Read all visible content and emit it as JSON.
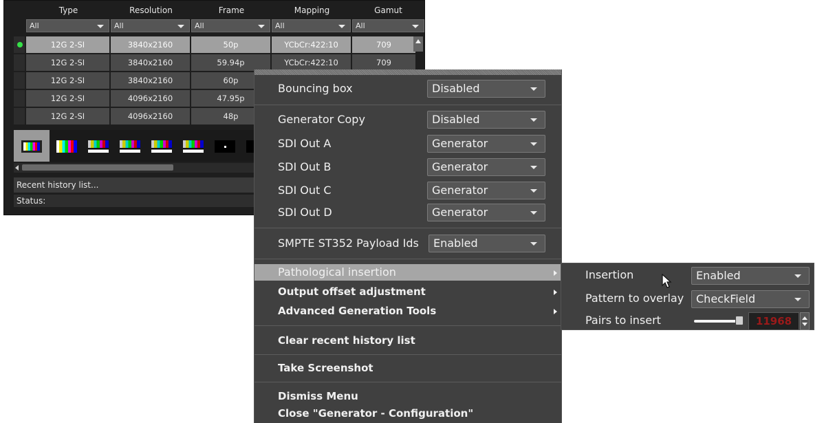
{
  "table": {
    "headers": [
      "Type",
      "Resolution",
      "Frame",
      "Mapping",
      "Gamut"
    ],
    "filters": [
      "All",
      "All",
      "All",
      "All",
      "All"
    ],
    "rows": [
      [
        "12G 2-SI",
        "3840x2160",
        "50p",
        "YCbCr:422:10",
        "709"
      ],
      [
        "12G 2-SI",
        "3840x2160",
        "59.94p",
        "YCbCr:422:10",
        "709"
      ],
      [
        "12G 2-SI",
        "3840x2160",
        "60p",
        "",
        ""
      ],
      [
        "12G 2-SI",
        "4096x2160",
        "47.95p",
        "",
        ""
      ],
      [
        "12G 2-SI",
        "4096x2160",
        "48p",
        "",
        ""
      ]
    ],
    "history_label": "Recent history list...",
    "status_label": "Status:"
  },
  "menu": {
    "bouncing_box": {
      "label": "Bouncing box",
      "value": "Disabled"
    },
    "generator_copy": {
      "label": "Generator Copy",
      "value": "Disabled"
    },
    "sdi_a": {
      "label": "SDI Out A",
      "value": "Generator"
    },
    "sdi_b": {
      "label": "SDI Out B",
      "value": "Generator"
    },
    "sdi_c": {
      "label": "SDI Out C",
      "value": "Generator"
    },
    "sdi_d": {
      "label": "SDI Out D",
      "value": "Generator"
    },
    "smpte": {
      "label": "SMPTE ST352 Payload Ids",
      "value": "Enabled"
    },
    "pathological": "Pathological insertion",
    "output_offset": "Output offset adjustment",
    "advanced": "Advanced Generation Tools",
    "clear_history": "Clear recent history list",
    "screenshot": "Take Screenshot",
    "dismiss": "Dismiss Menu",
    "close": "Close \"Generator - Configuration\""
  },
  "submenu": {
    "insertion": {
      "label": "Insertion",
      "value": "Enabled"
    },
    "pattern": {
      "label": "Pattern to overlay",
      "value": "CheckField"
    },
    "pairs": {
      "label": "Pairs to insert",
      "value": "11968"
    }
  },
  "colors": {
    "menu_bg": "#404040",
    "highlight": "#a6a6a6",
    "active_dot": "#36e048",
    "spin_value": "#9b1a1a"
  }
}
